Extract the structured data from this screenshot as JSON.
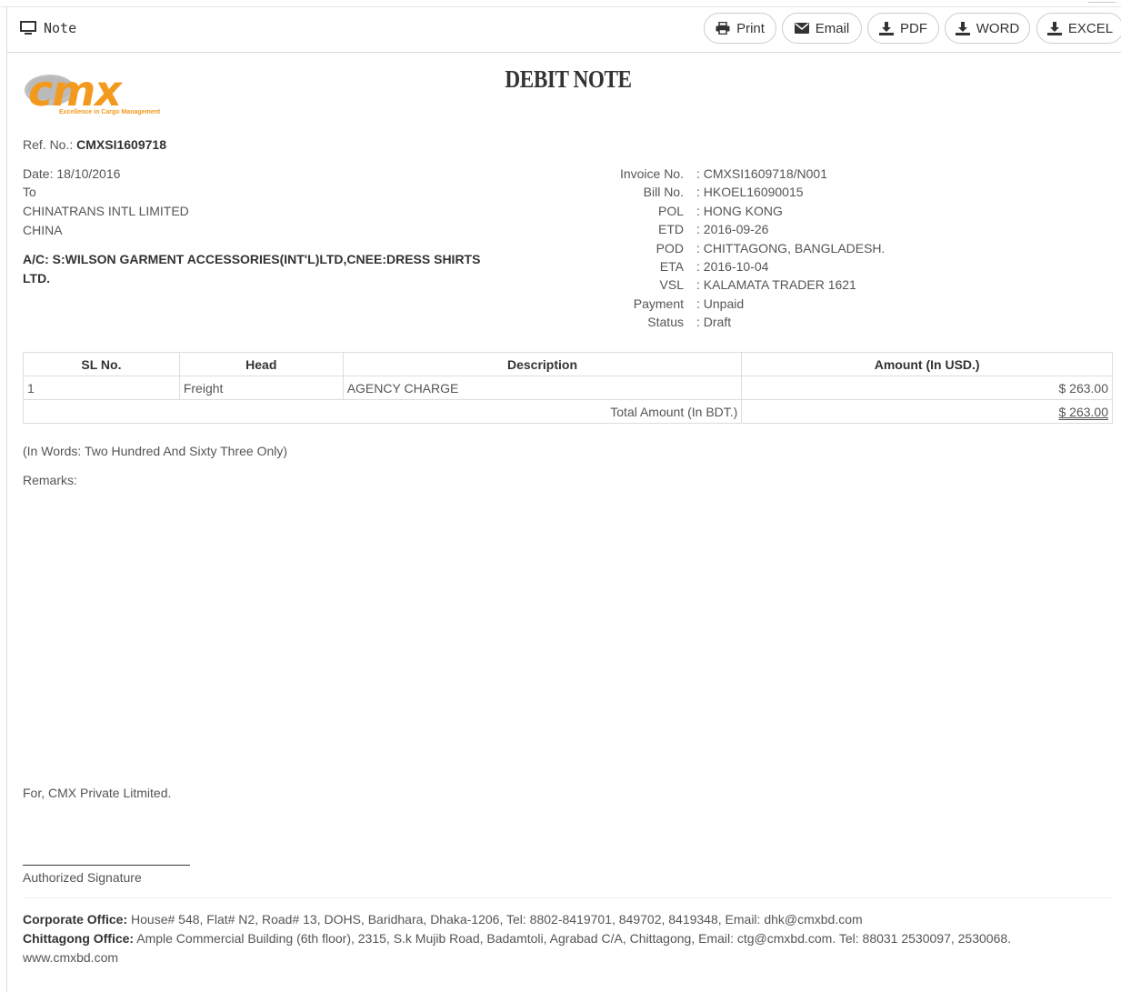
{
  "panel": {
    "title": "Note"
  },
  "toolbar": {
    "print": "Print",
    "email": "Email",
    "pdf": "PDF",
    "word": "WORD",
    "excel": "EXCEL"
  },
  "logo": {
    "wordmark": "cmx",
    "tagline": "Excellence in Cargo Management"
  },
  "document": {
    "title": "DEBIT NOTE",
    "ref_label": "Ref. No.:",
    "ref_no": "CMXSI1609718",
    "date": "Date: 18/10/2016",
    "to_label": "To",
    "recipient_name": "CHINATRANS INTL LIMITED",
    "recipient_country": "CHINA",
    "account_line1": "A/C: S:WILSON GARMENT ACCESSORIES(INT'L)LTD,CNEE:DRESS SHIRTS",
    "account_line2": "LTD."
  },
  "info": [
    {
      "label": "Invoice No.",
      "value": ": CMXSI1609718/N001"
    },
    {
      "label": "Bill No.",
      "value": ": HKOEL16090015"
    },
    {
      "label": "POL",
      "value": ": HONG KONG"
    },
    {
      "label": "ETD",
      "value": ": 2016-09-26"
    },
    {
      "label": "POD",
      "value": ": CHITTAGONG, BANGLADESH."
    },
    {
      "label": "ETA",
      "value": ": 2016-10-04"
    },
    {
      "label": "VSL",
      "value": ": KALAMATA TRADER 1621"
    },
    {
      "label": "Payment",
      "value": ": Unpaid"
    },
    {
      "label": "Status",
      "value": ": Draft"
    }
  ],
  "table": {
    "headers": [
      "SL No.",
      "Head",
      "Description",
      "Amount (In USD.)"
    ],
    "rows": [
      {
        "sl": "1",
        "head": "Freight",
        "description": "AGENCY CHARGE",
        "amount": "$ 263.00"
      }
    ],
    "total_label": "Total Amount (In BDT.)",
    "total_value": "$ 263.00"
  },
  "in_words": "(In Words: Two Hundred And Sixty Three Only)",
  "remarks": "Remarks:",
  "signoff": "For, CMX Private Litmited.",
  "signature_label": "Authorized Signature",
  "footer": {
    "corporate_label": "Corporate Office:",
    "corporate_text": "House# 548, Flat# N2, Road# 13, DOHS, Baridhara, Dhaka-1206, Tel: 8802-8419701, 849702, 8419348, Email: dhk@cmxbd.com",
    "chittagong_label": "Chittagong Office:",
    "chittagong_text": "Ample Commercial Building (6th floor), 2315, S.k Mujib Road, Badamtoli, Agrabad C/A, Chittagong, Email: ctg@cmxbd.com. Tel: 88031 2530097, 2530068.",
    "website": "www.cmxbd.com"
  },
  "colors": {
    "logo_orange": "#f39a1e",
    "logo_gray": "#7a7a7a",
    "text": "#555555",
    "heading": "#333333"
  }
}
